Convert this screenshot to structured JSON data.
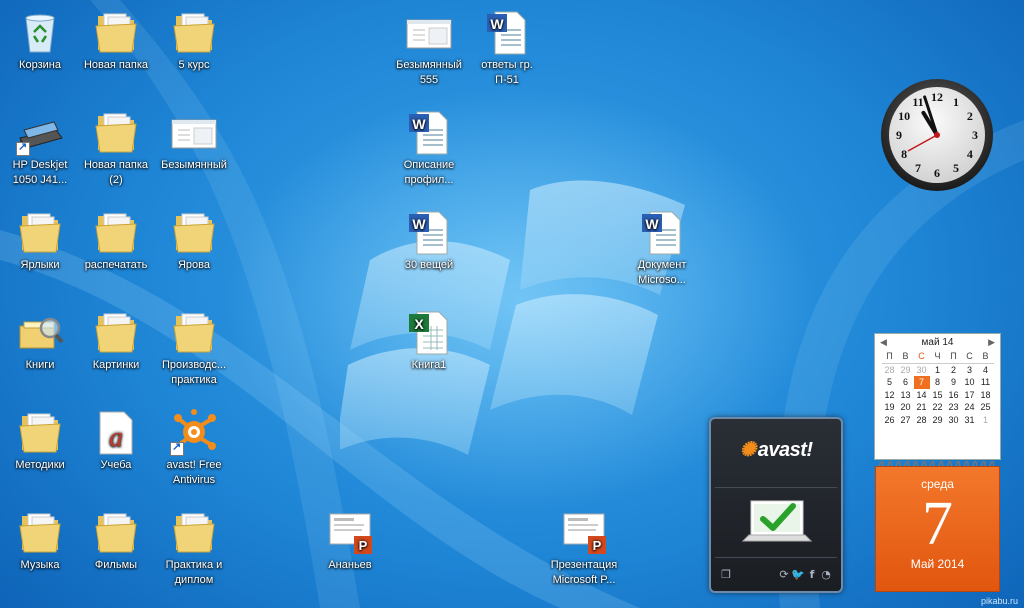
{
  "desktop_icons": [
    {
      "id": "recycle-bin",
      "icon": "recycle-bin-icon",
      "label": "Корзина"
    },
    {
      "id": "new-folder",
      "icon": "folder-icon",
      "label": "Новая папка"
    },
    {
      "id": "5-kurs",
      "icon": "folder-icon",
      "label": "5 курс"
    },
    {
      "id": "bezymyanny-555",
      "icon": "window-thumbnail-icon",
      "label": "Безымянный\n555"
    },
    {
      "id": "otvety-gr",
      "icon": "word-document-icon",
      "label": "ответы гр.\nП-51"
    },
    {
      "id": "hp-deskjet",
      "icon": "scanner-icon",
      "label": "HP Deskjet\n1050 J41..."
    },
    {
      "id": "new-folder-2",
      "icon": "folder-icon",
      "label": "Новая папка\n(2)"
    },
    {
      "id": "bezymyanny",
      "icon": "window-thumbnail-icon",
      "label": "Безымянный"
    },
    {
      "id": "opisanie",
      "icon": "word-document-icon",
      "label": "Описание\nпрофил..."
    },
    {
      "id": "yarlyki",
      "icon": "folder-icon",
      "label": "Ярлыки"
    },
    {
      "id": "raspechatat",
      "icon": "folder-icon",
      "label": "распечатать"
    },
    {
      "id": "yarova",
      "icon": "folder-icon",
      "label": "Ярова"
    },
    {
      "id": "30-veshchey",
      "icon": "word-document-icon",
      "label": "30 вещей"
    },
    {
      "id": "dokument-microsoft",
      "icon": "word-document-icon",
      "label": "Документ\nMicroso..."
    },
    {
      "id": "knigi",
      "icon": "library-icon",
      "label": "Книги"
    },
    {
      "id": "kartinki",
      "icon": "folder-icon",
      "label": "Картинки"
    },
    {
      "id": "proizvodstvennaya",
      "icon": "folder-icon",
      "label": "Производс...\nпрактика"
    },
    {
      "id": "kniga1",
      "icon": "excel-workbook-icon",
      "label": "Книга1"
    },
    {
      "id": "metodiki",
      "icon": "folder-icon",
      "label": "Методики"
    },
    {
      "id": "ucheba",
      "icon": "font-file-icon",
      "label": "Учеба"
    },
    {
      "id": "avast-free",
      "icon": "avast-icon",
      "label": "avast! Free\nAntivirus"
    },
    {
      "id": "muzyka",
      "icon": "folder-icon",
      "label": "Музыка"
    },
    {
      "id": "filmy",
      "icon": "folder-icon",
      "label": "Фильмы"
    },
    {
      "id": "praktika-diplom",
      "icon": "folder-icon",
      "label": "Практика и\nдиплом"
    },
    {
      "id": "ananev",
      "icon": "powerpoint-icon",
      "label": "Ананьев"
    },
    {
      "id": "prezentatsiya",
      "icon": "powerpoint-icon",
      "label": "Презентация\nMicrosoft P..."
    }
  ],
  "clock": {
    "hour": 10,
    "minute": 57,
    "numerals": [
      "12",
      "1",
      "2",
      "3",
      "4",
      "5",
      "6",
      "7",
      "8",
      "9",
      "10",
      "11"
    ]
  },
  "avast_gadget": {
    "brand": "avast!",
    "status_icon": "laptop-checkmark-icon",
    "bottom_icons": [
      "window-icon",
      "refresh-icon",
      "twitter-icon",
      "facebook-icon",
      "rss-icon"
    ]
  },
  "calendar": {
    "month_label": "май 14",
    "weekdays": [
      "П",
      "В",
      "С",
      "Ч",
      "П",
      "С",
      "В"
    ],
    "weeks": [
      [
        "28",
        "29",
        "30",
        "1",
        "2",
        "3",
        "4"
      ],
      [
        "5",
        "6",
        "7",
        "8",
        "9",
        "10",
        "11"
      ],
      [
        "12",
        "13",
        "14",
        "15",
        "16",
        "17",
        "18"
      ],
      [
        "19",
        "20",
        "21",
        "22",
        "23",
        "24",
        "25"
      ],
      [
        "26",
        "27",
        "28",
        "29",
        "30",
        "31",
        "1"
      ]
    ],
    "today": "7",
    "weekday_full": "среда",
    "day_big": "7",
    "month_year": "Май 2014"
  },
  "watermark": "pikabu.ru",
  "colors": {
    "desktop_blue": "#1f86d6",
    "calendar_orange": "#f07020",
    "avast_orange": "#f28c1b"
  }
}
